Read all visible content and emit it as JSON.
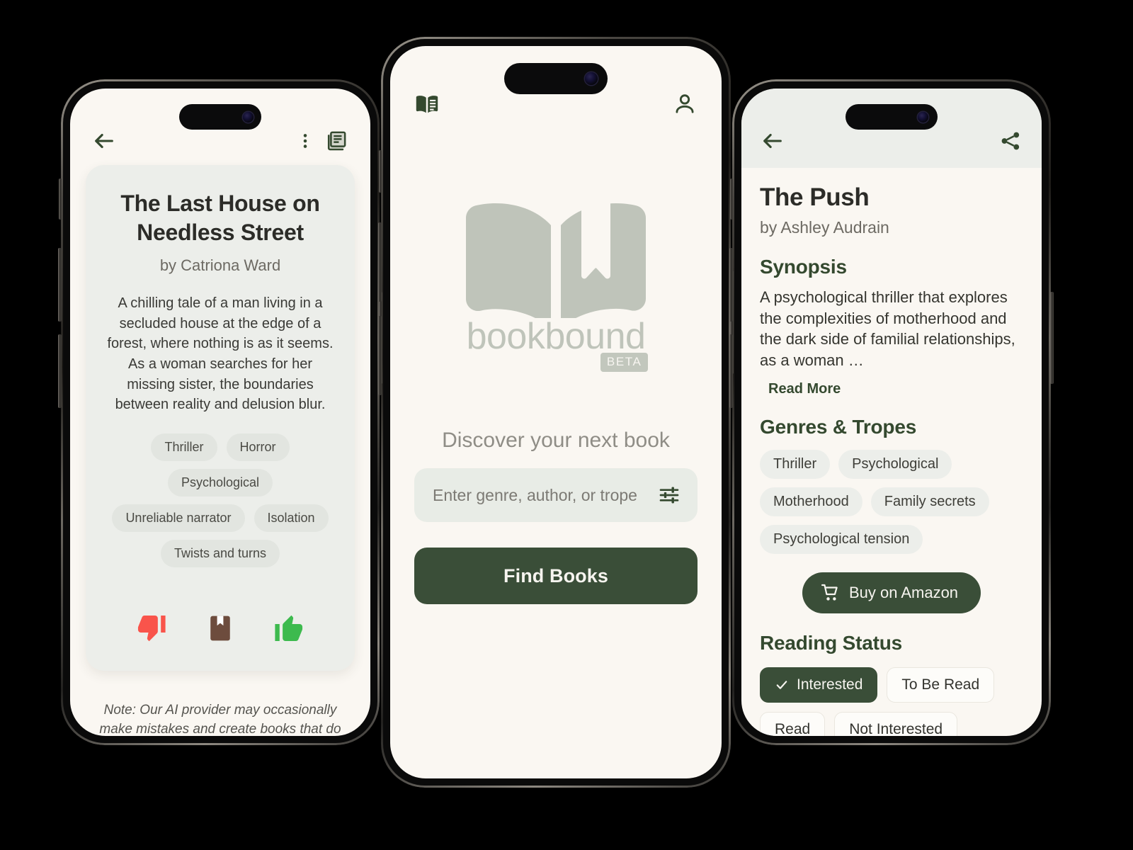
{
  "theme": {
    "page_bg": "#faf7f2",
    "card_bg": "#eceeea",
    "accent_green": "#3a4e38",
    "heading_green": "#34492f",
    "logo_grey": "#bfc4ba",
    "thumbs_down_red": "#f9544b",
    "bookmark_brown": "#6d4c3d",
    "thumbs_up_green": "#3dba4e"
  },
  "left_phone": {
    "topbar": {
      "back_icon": "arrow-left-icon",
      "overflow_icon": "more-vertical-icon",
      "library_icon": "library-books-icon"
    },
    "card": {
      "title": "The Last House on Needless Street",
      "author": "by Catriona Ward",
      "description": "A chilling tale of a man living in a secluded house at the edge of a forest, where nothing is as it seems. As a woman searches for her missing sister, the boundaries between reality and delusion blur.",
      "tags": [
        "Thriller",
        "Horror",
        "Psychological",
        "Unreliable narrator",
        "Isolation",
        "Twists and turns"
      ],
      "reactions": [
        {
          "name": "thumbs-down-icon",
          "label": "Dislike"
        },
        {
          "name": "bookmark-icon",
          "label": "Save"
        },
        {
          "name": "thumbs-up-icon",
          "label": "Like"
        }
      ]
    },
    "note": "Note: Our AI provider may occasionally make mistakes and create books that do not exist."
  },
  "center_phone": {
    "topbar": {
      "menu_icon": "open-book-icon",
      "profile_icon": "person-icon"
    },
    "logo": {
      "mark_icon": "open-book-bookmark-icon",
      "wordmark": "bookbound",
      "badge": "BETA"
    },
    "tagline": "Discover your next book",
    "search": {
      "value": "",
      "placeholder": "Enter genre, author, or trope",
      "filter_icon": "tune-sliders-icon"
    },
    "primary_button": "Find Books"
  },
  "right_phone": {
    "topbar": {
      "back_icon": "arrow-left-icon",
      "share_icon": "share-icon"
    },
    "title": "The Push",
    "author": "by Ashley Audrain",
    "synopsis_heading": "Synopsis",
    "synopsis": "A psychological thriller that explores the complexities of motherhood and the dark side of familial relationships, as a woman …",
    "read_more": "Read More",
    "genres_heading": "Genres & Tropes",
    "genres": [
      "Thriller",
      "Psychological",
      "Motherhood",
      "Family secrets",
      "Psychological tension"
    ],
    "buy_button": {
      "label": "Buy on Amazon",
      "icon": "shopping-cart-icon"
    },
    "status_heading": "Reading Status",
    "status_options": [
      {
        "label": "Interested",
        "active": true
      },
      {
        "label": "To Be Read",
        "active": false
      },
      {
        "label": "Read",
        "active": false
      },
      {
        "label": "Not Interested",
        "active": false
      }
    ]
  }
}
